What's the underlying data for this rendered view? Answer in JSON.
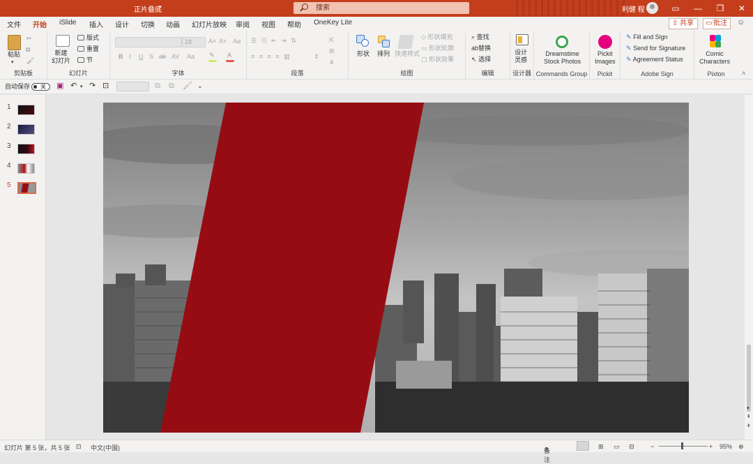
{
  "titlebar": {
    "filename": "正片叠底",
    "search_placeholder": "搜索",
    "user": "利健 程",
    "min": "—",
    "restore": "❐",
    "close": "✕",
    "ribbon_mode": "▭"
  },
  "menu": {
    "tabs": [
      "文件",
      "开始",
      "iSlide",
      "插入",
      "设计",
      "切换",
      "动画",
      "幻灯片放映",
      "审阅",
      "视图",
      "帮助",
      "OneKey Lite"
    ],
    "active": 1,
    "share": "共享",
    "comment": "批注"
  },
  "ribbon": {
    "clipboard": {
      "paste": "粘贴",
      "label": "剪贴板"
    },
    "slides": {
      "new_slide": "新建\n幻灯片",
      "layout": "版式",
      "reset": "重置",
      "section": "节",
      "label": "幻灯片"
    },
    "font": {
      "size": "18",
      "label": "字体",
      "bold": "B",
      "italic": "I",
      "underline": "U",
      "strike": "S",
      "ab": "ab",
      "av": "AV",
      "aa": "Aa"
    },
    "paragraph": {
      "label": "段落"
    },
    "drawing": {
      "shape": "形状",
      "arrange": "排列",
      "quick_styles": "快速样式",
      "fill": "形状填充",
      "outline": "形状轮廓",
      "effects": "形状效果",
      "label": "绘图"
    },
    "editing": {
      "find": "查找",
      "replace": "替换",
      "select": "选择",
      "label": "编辑"
    },
    "designer": {
      "ideas": "设计\n灵感",
      "label": "设计器"
    },
    "commands": {
      "dreamstime": "Dreamstime\nStock Photos",
      "label": "Commands Group"
    },
    "pickit": {
      "images": "Pickit\nImages",
      "label": "Pickit"
    },
    "adobe": {
      "fill_sign": "Fill and Sign",
      "send": "Send for Signature",
      "status": "Agreement Status",
      "label": "Adobe Sign"
    },
    "pixton": {
      "comic": "Comic\nCharacters",
      "label": "Pixton"
    }
  },
  "quickaccess": {
    "autosave": "自动保存",
    "toggle": "关"
  },
  "slides_panel": {
    "numbers": [
      "1",
      "2",
      "3",
      "4",
      "5"
    ],
    "selected": 5
  },
  "status": {
    "slide_info": "幻灯片 第 5 张，共 5 张",
    "language": "中文(中国)",
    "notes": "备注",
    "zoom": "95%"
  },
  "colors": {
    "accent": "#c43e1c",
    "red_band": "#960c13"
  }
}
